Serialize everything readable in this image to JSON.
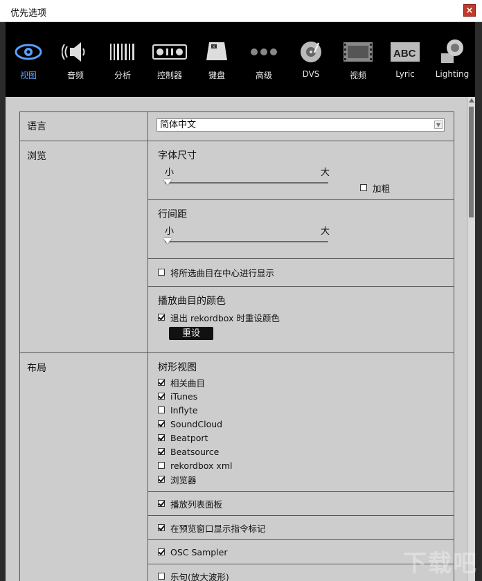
{
  "window": {
    "title": "优先选项",
    "close": "×"
  },
  "toolbar": [
    {
      "label": "视图",
      "icon": "eye-icon",
      "active": true
    },
    {
      "label": "音频",
      "icon": "speaker-icon"
    },
    {
      "label": "分析",
      "icon": "analysis-bars-icon"
    },
    {
      "label": "控制器",
      "icon": "controller-icon"
    },
    {
      "label": "键盘",
      "icon": "keyboard-icon"
    },
    {
      "label": "高级",
      "icon": "more-dots-icon"
    },
    {
      "label": "DVS",
      "icon": "turntable-icon"
    },
    {
      "label": "视频",
      "icon": "film-icon"
    },
    {
      "label": "Lyric",
      "icon": "abc-lyric-icon"
    },
    {
      "label": "Lighting",
      "icon": "lighting-icon"
    }
  ],
  "language": {
    "category": "语言",
    "selected": "简体中文"
  },
  "browse": {
    "category": "浏览",
    "font_size": {
      "title": "字体尺寸",
      "min": "小",
      "max": "大",
      "bold": "加粗"
    },
    "line_spacing": {
      "title": "行间距",
      "min": "小",
      "max": "大"
    },
    "center_display": "将所选曲目在中心进行显示",
    "play_color": {
      "title": "播放曲目的颜色",
      "reset_on_exit": "退出 rekordbox 时重设颜色",
      "reset_button": "重设"
    }
  },
  "layout": {
    "category": "布局",
    "tree_title": "树形视图",
    "tree_items": [
      {
        "label": "相关曲目",
        "checked": true
      },
      {
        "label": "iTunes",
        "checked": true
      },
      {
        "label": "Inflyte",
        "checked": false
      },
      {
        "label": "SoundCloud",
        "checked": true
      },
      {
        "label": "Beatport",
        "checked": true
      },
      {
        "label": "Beatsource",
        "checked": true
      },
      {
        "label": "rekordbox xml",
        "checked": false
      },
      {
        "label": "浏览器",
        "checked": true
      }
    ],
    "playlist_panel": "播放列表面板",
    "cue_marks": "在预览窗口显示指令标记",
    "osc_sampler": "OSC Sampler",
    "phrase_partial": "乐句(放大波形)"
  },
  "watermark": "下载吧"
}
